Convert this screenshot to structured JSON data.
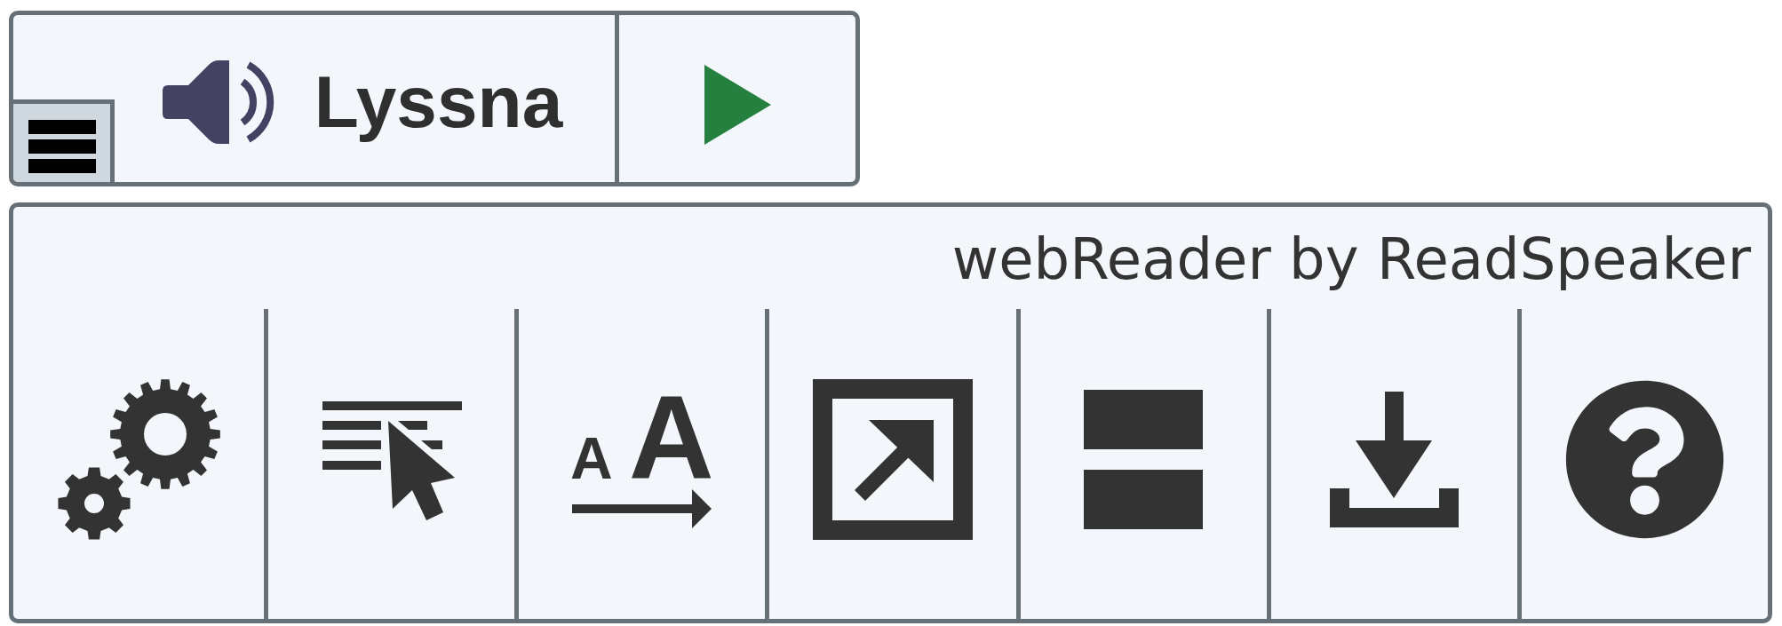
{
  "player": {
    "label": "Lyssna"
  },
  "toolbar": {
    "brand": "webReader by ReadSpeaker",
    "text_size_letters": [
      "A",
      "A"
    ]
  }
}
